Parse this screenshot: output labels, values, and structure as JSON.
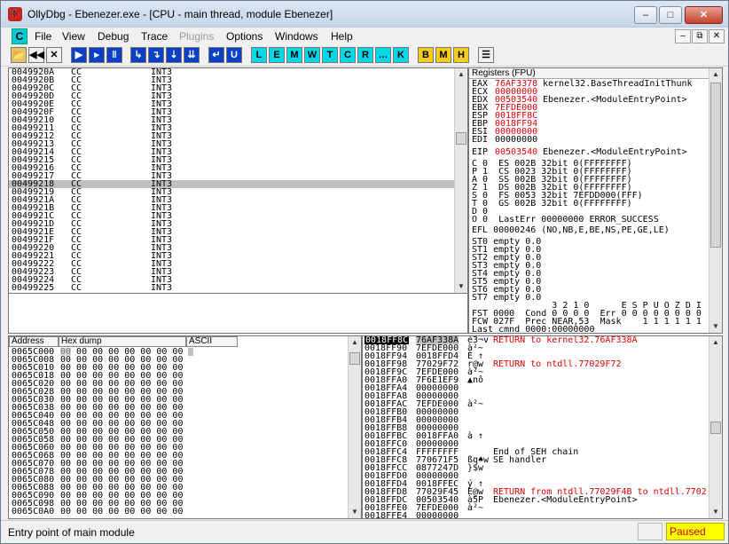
{
  "window": {
    "title": "OllyDbg - Ebenezer.exe - [CPU - main thread, module Ebenezer]",
    "icon_label": "🐞"
  },
  "caption_buttons": {
    "minimize": "–",
    "maximize": "□",
    "close": "✕"
  },
  "menu": {
    "logo": "C",
    "items": [
      "File",
      "View",
      "Debug",
      "Trace",
      "Plugins",
      "Options",
      "Windows",
      "Help"
    ],
    "disabled": [
      "Plugins"
    ]
  },
  "mdi_buttons": {
    "minimize": "–",
    "restore": "⧉",
    "close": "✕"
  },
  "toolbar": {
    "buttons": [
      {
        "name": "open",
        "label": "📂",
        "style": "folder"
      },
      {
        "name": "restart",
        "label": "◀◀",
        "style": "plain"
      },
      {
        "name": "close-program",
        "label": "✕",
        "style": "plain"
      },
      {
        "name": "run",
        "label": "▶",
        "style": "blue"
      },
      {
        "name": "run-thread",
        "label": "▸",
        "style": "blue"
      },
      {
        "name": "pause",
        "label": "‖",
        "style": "blue"
      },
      {
        "name": "step-into",
        "label": "↳",
        "style": "blue"
      },
      {
        "name": "step-over",
        "label": "↴",
        "style": "blue"
      },
      {
        "name": "trace-into",
        "label": "⇣",
        "style": "blue"
      },
      {
        "name": "trace-over",
        "label": "⇊",
        "style": "blue"
      },
      {
        "name": "execute-till-return",
        "label": "↵",
        "style": "blue"
      },
      {
        "name": "execute-till-user",
        "label": "U",
        "style": "blue"
      },
      {
        "name": "log",
        "label": "L",
        "style": "cyan"
      },
      {
        "name": "modules",
        "label": "E",
        "style": "cyan"
      },
      {
        "name": "memory",
        "label": "M",
        "style": "cyan"
      },
      {
        "name": "windows",
        "label": "W",
        "style": "cyan"
      },
      {
        "name": "threads",
        "label": "T",
        "style": "cyan"
      },
      {
        "name": "cpu",
        "label": "C",
        "style": "cyan"
      },
      {
        "name": "references",
        "label": "R",
        "style": "cyan"
      },
      {
        "name": "run-trace",
        "label": "…",
        "style": "cyan"
      },
      {
        "name": "call-stack",
        "label": "K",
        "style": "cyan"
      },
      {
        "name": "breakpoints",
        "label": "B",
        "style": "yellow"
      },
      {
        "name": "memory-breakpoints",
        "label": "M",
        "style": "yellow"
      },
      {
        "name": "hardware-breakpoints",
        "label": "H",
        "style": "yellow"
      },
      {
        "name": "list",
        "label": "☰",
        "style": "plain"
      }
    ]
  },
  "disasm": {
    "rows": [
      [
        "0049920A",
        "CC",
        "INT3"
      ],
      [
        "0049920B",
        "CC",
        "INT3"
      ],
      [
        "0049920C",
        "CC",
        "INT3"
      ],
      [
        "0049920D",
        "CC",
        "INT3"
      ],
      [
        "0049920E",
        "CC",
        "INT3"
      ],
      [
        "0049920F",
        "CC",
        "INT3"
      ],
      [
        "00499210",
        "CC",
        "INT3"
      ],
      [
        "00499211",
        "CC",
        "INT3"
      ],
      [
        "00499212",
        "CC",
        "INT3"
      ],
      [
        "00499213",
        "CC",
        "INT3"
      ],
      [
        "00499214",
        "CC",
        "INT3"
      ],
      [
        "00499215",
        "CC",
        "INT3"
      ],
      [
        "00499216",
        "CC",
        "INT3"
      ],
      [
        "00499217",
        "CC",
        "INT3"
      ],
      [
        "00499218",
        "CC",
        "INT3"
      ],
      [
        "00499219",
        "CC",
        "INT3"
      ],
      [
        "0049921A",
        "CC",
        "INT3"
      ],
      [
        "0049921B",
        "CC",
        "INT3"
      ],
      [
        "0049921C",
        "CC",
        "INT3"
      ],
      [
        "0049921D",
        "CC",
        "INT3"
      ],
      [
        "0049921E",
        "CC",
        "INT3"
      ],
      [
        "0049921F",
        "CC",
        "INT3"
      ],
      [
        "00499220",
        "CC",
        "INT3"
      ],
      [
        "00499221",
        "CC",
        "INT3"
      ],
      [
        "00499222",
        "CC",
        "INT3"
      ],
      [
        "00499223",
        "CC",
        "INT3"
      ],
      [
        "00499224",
        "CC",
        "INT3"
      ],
      [
        "00499225",
        "CC",
        "INT3"
      ]
    ],
    "selected_address": "00499218"
  },
  "registers": {
    "header": "Registers (FPU)",
    "lines": [
      {
        "name": "EAX",
        "value": "76AF3378",
        "comment": "kernel32.BaseThreadInitThunk",
        "changed": true
      },
      {
        "name": "ECX",
        "value": "00000000",
        "comment": "",
        "changed": true
      },
      {
        "name": "EDX",
        "value": "00503540",
        "comment": "Ebenezer.<ModuleEntryPoint>",
        "changed": true
      },
      {
        "name": "EBX",
        "value": "7EFDE000",
        "comment": "",
        "changed": true
      },
      {
        "name": "ESP",
        "value": "0018FF8C",
        "comment": "",
        "changed": true
      },
      {
        "name": "EBP",
        "value": "0018FF94",
        "comment": "",
        "changed": true
      },
      {
        "name": "ESI",
        "value": "00000000",
        "comment": "",
        "changed": true
      },
      {
        "name": "EDI",
        "value": "00000000",
        "comment": "",
        "changed": false
      },
      {
        "name": "",
        "value": "",
        "comment": "",
        "changed": false
      },
      {
        "name": "EIP",
        "value": "00503540",
        "comment": "Ebenezer.<ModuleEntryPoint>",
        "changed": true
      }
    ],
    "flags": [
      "C 0  ES 002B 32bit 0(FFFFFFFF)",
      "P 1  CS 0023 32bit 0(FFFFFFFF)",
      "A 0  SS 002B 32bit 0(FFFFFFFF)",
      "Z 1  DS 002B 32bit 0(FFFFFFFF)",
      "S 0  FS 0053 32bit 7EFDD000(FFF)",
      "T 0  GS 002B 32bit 0(FFFFFFFF)",
      "D 0",
      "O 0  LastErr 00000000 ERROR_SUCCESS"
    ],
    "efl": "EFL 00000246 (NO,NB,E,BE,NS,PE,GE,LE)",
    "fpu": [
      "ST0 empty 0.0",
      "ST1 empty 0.0",
      "ST2 empty 0.0",
      "ST3 empty 0.0",
      "ST4 empty 0.0",
      "ST5 empty 0.0",
      "ST6 empty 0.0",
      "ST7 empty 0.0"
    ],
    "fpu_bits_header": "               3 2 1 0      E S P U O Z D I",
    "fst": "FST 0000  Cond 0 0 0 0  Err 0 0 0 0 0 0 0 0",
    "fcw": "FCW 027F  Prec NEAR,53  Mask    1 1 1 1 1 1",
    "last_cmnd": "Last cmnd 0000:00000000"
  },
  "dump": {
    "headers": {
      "address": "Address",
      "hex": "Hex dump",
      "ascii": "ASCII"
    },
    "hex_bytes": "00 00 00 00 00 00 00 00",
    "rows": [
      "0065C000",
      "0065C008",
      "0065C010",
      "0065C018",
      "0065C020",
      "0065C028",
      "0065C030",
      "0065C038",
      "0065C040",
      "0065C048",
      "0065C050",
      "0065C058",
      "0065C060",
      "0065C068",
      "0065C070",
      "0065C078",
      "0065C080",
      "0065C088",
      "0065C090",
      "0065C098",
      "0065C0A0"
    ]
  },
  "stack": {
    "rows": [
      {
        "addr": "0018FF8C",
        "value": "76AF338A",
        "ascii": "è3¬v",
        "comment": "RETURN to kernel32.76AF338A",
        "red": true,
        "sel": true
      },
      {
        "addr": "0018FF90",
        "value": "7EFDE000",
        "ascii": "à²~",
        "comment": "",
        "red": false,
        "sel": false
      },
      {
        "addr": "0018FF94",
        "value": "0018FFD4",
        "ascii": "È ↑",
        "comment": "",
        "red": false,
        "sel": false
      },
      {
        "addr": "0018FF98",
        "value": "77029F72",
        "ascii": "r@w",
        "comment": "RETURN to ntdll.77029F72",
        "red": true,
        "sel": false
      },
      {
        "addr": "0018FF9C",
        "value": "7EFDE000",
        "ascii": "à²~",
        "comment": "",
        "red": false,
        "sel": false
      },
      {
        "addr": "0018FFA0",
        "value": "7F6E1EF9",
        "ascii": "▲nô",
        "comment": "",
        "red": false,
        "sel": false
      },
      {
        "addr": "0018FFA4",
        "value": "00000000",
        "ascii": "",
        "comment": "",
        "red": false,
        "sel": false
      },
      {
        "addr": "0018FFA8",
        "value": "00000000",
        "ascii": "",
        "comment": "",
        "red": false,
        "sel": false
      },
      {
        "addr": "0018FFAC",
        "value": "7EFDE000",
        "ascii": "à²~",
        "comment": "",
        "red": false,
        "sel": false
      },
      {
        "addr": "0018FFB0",
        "value": "00000000",
        "ascii": "",
        "comment": "",
        "red": false,
        "sel": false
      },
      {
        "addr": "0018FFB4",
        "value": "00000000",
        "ascii": "",
        "comment": "",
        "red": false,
        "sel": false
      },
      {
        "addr": "0018FFB8",
        "value": "00000000",
        "ascii": "",
        "comment": "",
        "red": false,
        "sel": false
      },
      {
        "addr": "0018FFBC",
        "value": "0018FFA0",
        "ascii": "à ↑",
        "comment": "",
        "red": false,
        "sel": false
      },
      {
        "addr": "0018FFC0",
        "value": "00000000",
        "ascii": "",
        "comment": "",
        "red": false,
        "sel": false
      },
      {
        "addr": "0018FFC4",
        "value": "FFFFFFFF",
        "ascii": "",
        "comment": "End of SEH chain",
        "red": false,
        "sel": false
      },
      {
        "addr": "0018FFC8",
        "value": "770671F5",
        "ascii": "ßq♠w",
        "comment": "SE handler",
        "red": false,
        "sel": false
      },
      {
        "addr": "0018FFCC",
        "value": "0877247D",
        "ascii": "}$w",
        "comment": "",
        "red": false,
        "sel": false
      },
      {
        "addr": "0018FFD0",
        "value": "00000000",
        "ascii": "",
        "comment": "",
        "red": false,
        "sel": false
      },
      {
        "addr": "0018FFD4",
        "value": "0018FFEC",
        "ascii": "ý ↑",
        "comment": "",
        "red": false,
        "sel": false
      },
      {
        "addr": "0018FFD8",
        "value": "77029F45",
        "ascii": "E@w",
        "comment": "RETURN from ntdll.77029F4B to ntdll.7702",
        "red": true,
        "sel": false
      },
      {
        "addr": "0018FFDC",
        "value": "00503540",
        "ascii": "à5P",
        "comment": "Ebenezer.<ModuleEntryPoint>",
        "red": false,
        "sel": false
      },
      {
        "addr": "0018FFE0",
        "value": "7EFDE000",
        "ascii": "à²~",
        "comment": "",
        "red": false,
        "sel": false
      },
      {
        "addr": "0018FFE4",
        "value": "00000000",
        "ascii": "",
        "comment": "",
        "red": false,
        "sel": false
      }
    ]
  },
  "status": {
    "message": "Entry point of main module",
    "state": "Paused"
  },
  "colors": {
    "selected_row": "#c0c0c0",
    "changed": "#e00000",
    "paused_bg": "#ffff00"
  }
}
